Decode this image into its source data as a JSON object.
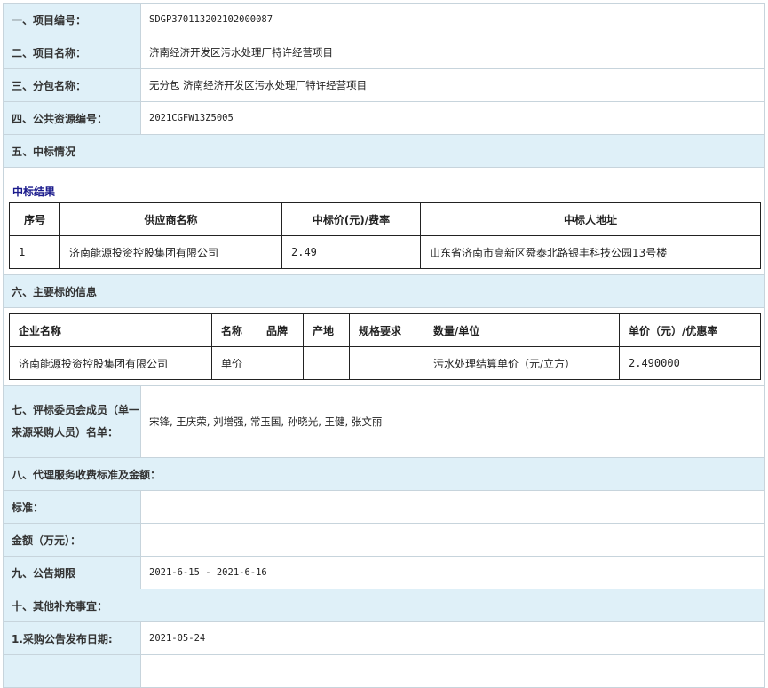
{
  "rows": {
    "project_no_label": "一、项目编号：",
    "project_no_value": "SDGP370113202102000087",
    "project_name_label": "二、项目名称：",
    "project_name_value": "济南经济开发区污水处理厂特许经营项目",
    "package_label": "三、分包名称：",
    "package_value": "无分包 济南经济开发区污水处理厂特许经营项目",
    "public_no_label": "四、公共资源编号：",
    "public_no_value": "2021CGFW13Z5005"
  },
  "winning": {
    "section_title": "五、中标情况",
    "sub_title": "中标结果",
    "headers": [
      "序号",
      "供应商名称",
      "中标价(元)/费率",
      "中标人地址"
    ],
    "row": [
      "1",
      "济南能源投资控股集团有限公司",
      "2.49",
      "山东省济南市高新区舜泰北路银丰科技公园13号楼"
    ]
  },
  "subject": {
    "section_title": "六、主要标的信息",
    "headers": [
      "企业名称",
      "名称",
      "品牌",
      "产地",
      "规格要求",
      "数量/单位",
      "单价（元）/优惠率"
    ],
    "row": [
      "济南能源投资控股集团有限公司",
      "单价",
      "",
      "",
      "",
      "污水处理结算单价（元/立方）",
      "2.490000"
    ]
  },
  "committee": {
    "label": "七、评标委员会成员（单一来源采购人员）名单：",
    "value": "宋锋, 王庆荣, 刘增强, 常玉国, 孙晓光, 王健, 张文丽"
  },
  "agency": {
    "section_title": "八、代理服务收费标准及金额：",
    "standard_label": "标准：",
    "standard_value": "",
    "amount_label": "金额（万元）：",
    "amount_value": ""
  },
  "period": {
    "label": "九、公告期限",
    "value": "2021-6-15 - 2021-6-16"
  },
  "other": {
    "section_title": "十、其他补充事宜：",
    "date_label": "1.采购公告发布日期:",
    "date_value": "2021-05-24"
  }
}
